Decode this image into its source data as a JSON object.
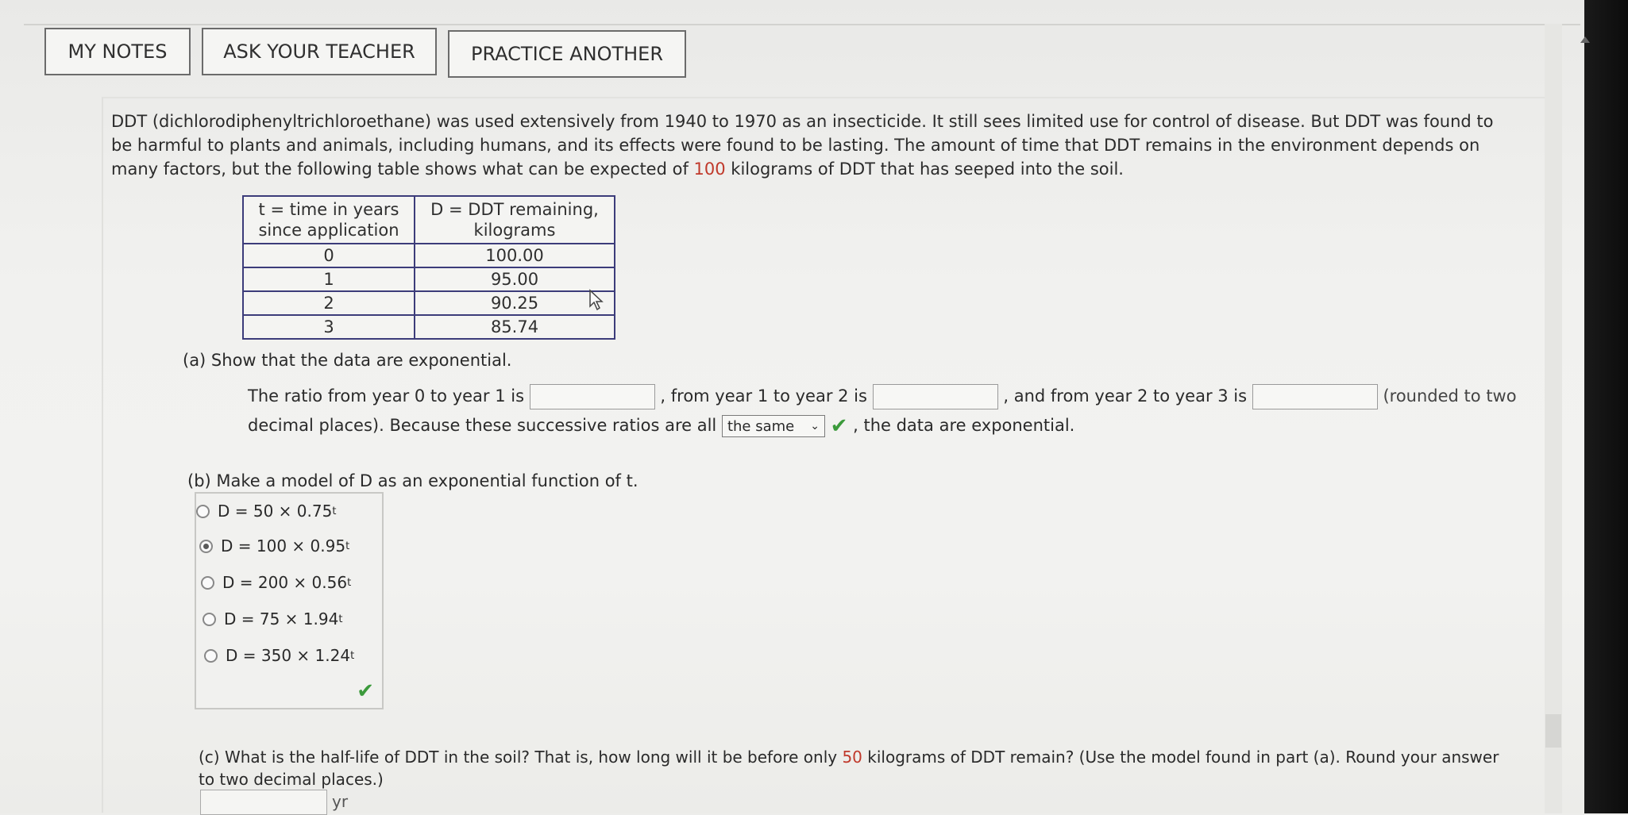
{
  "toolbar": {
    "my_notes": "MY NOTES",
    "ask_teacher": "ASK YOUR TEACHER",
    "practice_another": "PRACTICE ANOTHER"
  },
  "intro": {
    "p1": "DDT (dichlorodiphenyltrichloroethane) was used extensively from 1940 to 1970 as an insecticide. It still sees limited use for control of disease. But DDT was found to be harmful to plants and animals, including humans, and its effects were found to be lasting. The amount of time that DDT remains in the environment depends on many factors, but the following table shows what can be expected of ",
    "amount": "100",
    "p2": " kilograms of DDT that has seeped into the soil."
  },
  "table": {
    "h1_line1": "t = time in years",
    "h1_line2": "since application",
    "h2_line1": "D = DDT remaining,",
    "h2_line2": "kilograms",
    "rows": [
      {
        "t": "0",
        "d": "100.00"
      },
      {
        "t": "1",
        "d": "95.00"
      },
      {
        "t": "2",
        "d": "90.25"
      },
      {
        "t": "3",
        "d": "85.74"
      }
    ]
  },
  "part_a": {
    "title": "(a) Show that the data are exponential.",
    "s1": "The ratio from year 0 to year 1 is",
    "s2": ", from year 1 to year 2 is",
    "s3": ", and from year 2 to year 3 is",
    "s4": "(rounded to two",
    "s5": "decimal places). Because these successive ratios are all",
    "select_value": "the same",
    "s6": ", the data are exponential."
  },
  "part_b": {
    "title": "(b) Make a model of D as an exponential function of t.",
    "options": [
      {
        "lhs": "D = 50 × 0.75",
        "exp": "t",
        "selected": false
      },
      {
        "lhs": "D = 100 × 0.95",
        "exp": "t",
        "selected": true
      },
      {
        "lhs": "D = 200 × 0.56",
        "exp": "t",
        "selected": false
      },
      {
        "lhs": "D = 75 × 1.94",
        "exp": "t",
        "selected": false
      },
      {
        "lhs": "D = 350 × 1.24",
        "exp": "t",
        "selected": false
      }
    ]
  },
  "part_c": {
    "t1": "(c) What is the half-life of DDT in the soil? That is, how long will it be before only ",
    "amount": "50",
    "t2": " kilograms of DDT remain? (Use the model found in part (a). Round your answer to two decimal places.)",
    "unit": "yr"
  },
  "colors": {
    "accent_red": "#c0392b",
    "check_green": "#3b9a3b",
    "table_border": "#3c3c7a"
  }
}
